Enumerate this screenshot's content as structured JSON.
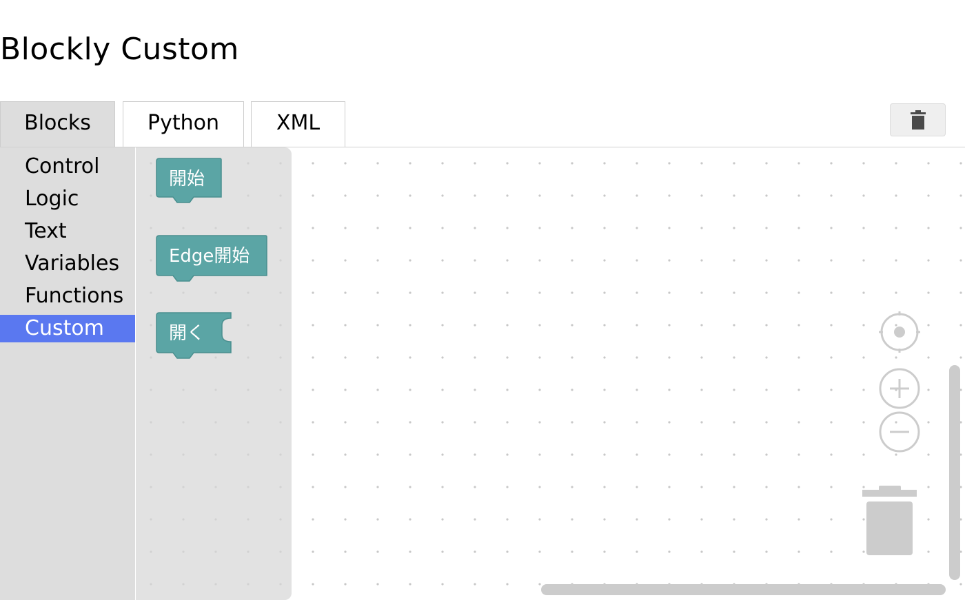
{
  "page": {
    "title": "Blockly Custom"
  },
  "tabs": [
    {
      "label": "Blocks",
      "active": true
    },
    {
      "label": "Python",
      "active": false
    },
    {
      "label": "XML",
      "active": false
    }
  ],
  "header_actions": {
    "trash_icon": "trash-icon"
  },
  "toolbox": {
    "categories": [
      {
        "label": "Control",
        "selected": false
      },
      {
        "label": "Logic",
        "selected": false
      },
      {
        "label": "Text",
        "selected": false
      },
      {
        "label": "Variables",
        "selected": false
      },
      {
        "label": "Functions",
        "selected": false
      },
      {
        "label": "Custom",
        "selected": true
      }
    ],
    "selected_color": "#5a78f0"
  },
  "flyout": {
    "blocks": [
      {
        "label": "開始",
        "shape": "top-level-with-next"
      },
      {
        "label": "Edge開始",
        "shape": "top-level-with-next"
      },
      {
        "label": "開く",
        "shape": "top-level-with-input"
      }
    ],
    "block_color": "#5ba5a5"
  },
  "workspace": {
    "controls": {
      "recenter_icon": "crosshair-icon",
      "zoom_in_icon": "plus-icon",
      "zoom_out_icon": "minus-icon",
      "trashcan_icon": "trash-can-icon"
    }
  }
}
